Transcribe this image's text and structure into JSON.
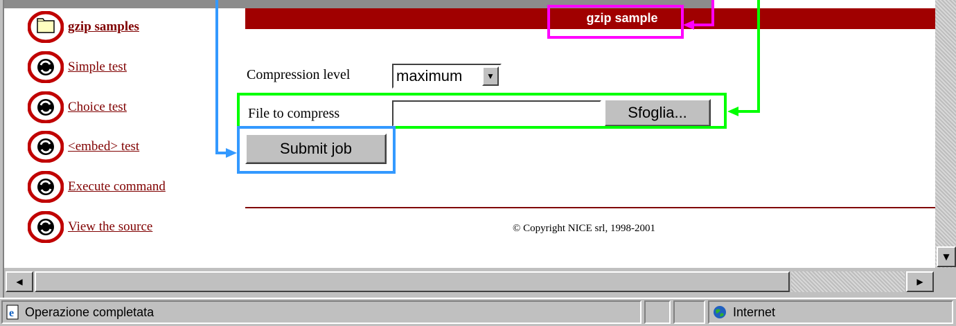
{
  "nav": {
    "items": [
      {
        "label": "gzip samples",
        "icon": "folder-icon",
        "bold": true
      },
      {
        "label": "Simple test",
        "icon": "refresh-icon"
      },
      {
        "label": "Choice test",
        "icon": "refresh-icon"
      },
      {
        "label": "<embed> test",
        "icon": "refresh-icon"
      },
      {
        "label": "Execute command",
        "icon": "refresh-icon"
      },
      {
        "label": "View the source",
        "icon": "refresh-icon"
      }
    ]
  },
  "content": {
    "title": "gzip sample",
    "compression_label": "Compression level",
    "compression_value": "maximum",
    "file_label": "File to compress",
    "file_value": "",
    "browse_label": "Sfoglia...",
    "submit_label": "Submit job",
    "copyright": "© Copyright NICE srl, 1998-2001"
  },
  "status": {
    "text": "Operazione completata",
    "zone": "Internet"
  },
  "colors": {
    "accent": "#a00000",
    "link": "#800000",
    "annotation_magenta": "#ff00ff",
    "annotation_green": "#00ff00",
    "annotation_blue": "#3399ff"
  }
}
